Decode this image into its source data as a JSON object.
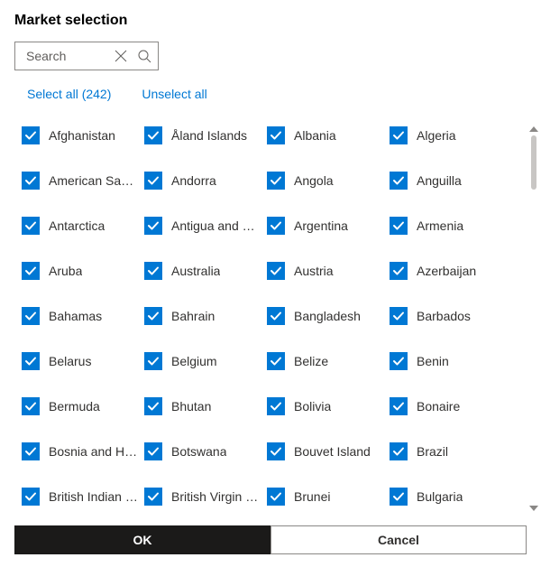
{
  "title": "Market selection",
  "search": {
    "placeholder": "Search"
  },
  "links": {
    "select_all": "Select all (242)",
    "unselect_all": "Unselect all"
  },
  "markets": [
    "Afghanistan",
    "Åland Islands",
    "Albania",
    "Algeria",
    "American Samoa",
    "Andorra",
    "Angola",
    "Anguilla",
    "Antarctica",
    "Antigua and Barbuda",
    "Argentina",
    "Armenia",
    "Aruba",
    "Australia",
    "Austria",
    "Azerbaijan",
    "Bahamas",
    "Bahrain",
    "Bangladesh",
    "Barbados",
    "Belarus",
    "Belgium",
    "Belize",
    "Benin",
    "Bermuda",
    "Bhutan",
    "Bolivia",
    "Bonaire",
    "Bosnia and Herzegovina",
    "Botswana",
    "Bouvet Island",
    "Brazil",
    "British Indian Ocean Territory",
    "British Virgin Islands",
    "Brunei",
    "Bulgaria"
  ],
  "footer": {
    "ok": "OK",
    "cancel": "Cancel"
  },
  "colors": {
    "accent": "#0078d4",
    "link": "#0078d4",
    "primary_btn": "#1b1a19"
  }
}
